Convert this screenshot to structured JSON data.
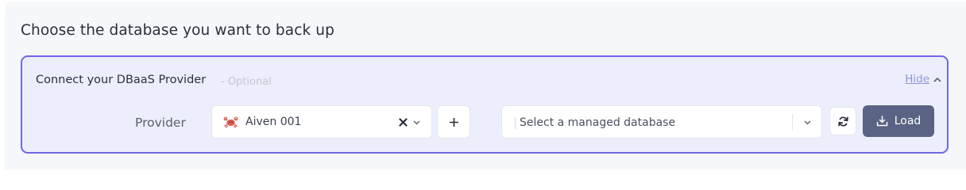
{
  "section": {
    "title": "Choose the database you want to back up"
  },
  "provider_panel": {
    "heading": "Connect your DBaaS Provider",
    "optional": "- Optional",
    "hide_label": "Hide",
    "provider_label": "Provider",
    "provider_select": {
      "value": "Aiven 001",
      "icon": "crab-icon"
    },
    "add_button_icon": "plus-icon",
    "database_select": {
      "placeholder": "Select a managed database"
    },
    "refresh_icon": "refresh-icon",
    "load_button": {
      "label": "Load",
      "icon": "download-tray-icon"
    }
  },
  "colors": {
    "panel_border": "#6f66e6",
    "panel_bg": "#eceefb",
    "link": "#8f96d8",
    "load_button_bg": "#5a6383",
    "crab": "#e05a4f"
  }
}
